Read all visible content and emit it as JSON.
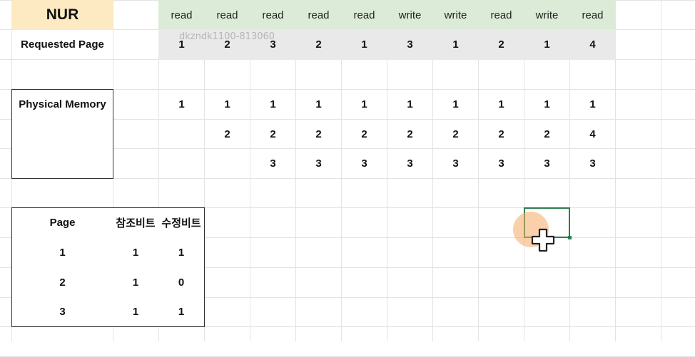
{
  "title": "NUR",
  "labels": {
    "requested_page": "Requested Page",
    "physical_memory": "Physical Memory"
  },
  "operations": [
    "read",
    "read",
    "read",
    "read",
    "read",
    "write",
    "write",
    "read",
    "write",
    "read"
  ],
  "requested_pages": [
    "1",
    "2",
    "3",
    "2",
    "1",
    "3",
    "1",
    "2",
    "1",
    "4"
  ],
  "memory_rows": [
    [
      "1",
      "1",
      "1",
      "1",
      "1",
      "1",
      "1",
      "1",
      "1",
      "1"
    ],
    [
      "",
      "2",
      "2",
      "2",
      "2",
      "2",
      "2",
      "2",
      "2",
      "4"
    ],
    [
      "",
      "",
      "3",
      "3",
      "3",
      "3",
      "3",
      "3",
      "3",
      "3"
    ]
  ],
  "page_table": {
    "headers": [
      "Page",
      "참조비트",
      "수정비트"
    ],
    "rows": [
      [
        "1",
        "1",
        "1"
      ],
      [
        "2",
        "1",
        "0"
      ],
      [
        "3",
        "1",
        "1"
      ]
    ]
  },
  "watermark": "dkzndk1100-813060",
  "colors": {
    "title_bg": "#fde9c2",
    "operation_bg": "#dcebd7",
    "requested_bg": "#e9e9e9",
    "selection": "#2e7d4f"
  },
  "cursor_icon": "crosshair-plus-icon"
}
